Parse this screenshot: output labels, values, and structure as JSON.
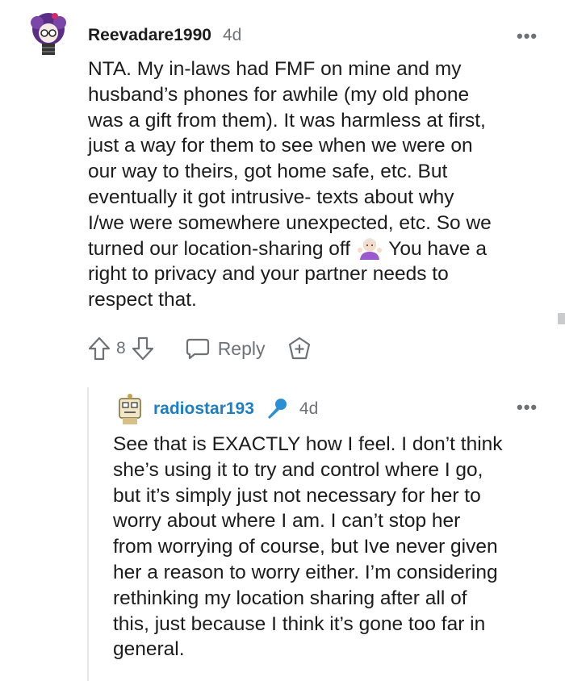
{
  "comment": {
    "username": "Reevadare1990",
    "age": "4d",
    "more_label": "•••",
    "lines": [
      "NTA. My in-laws had FMF on mine and my",
      "husband’s phones for awhile (my old phone",
      "was a gift from them). It was harmless at first,",
      "just a way for them to see when we were on",
      "our way to theirs, got home safe, etc. But",
      "eventually it got intrusive- texts about why",
      "I/we were somewhere unexpected, etc. So we",
      "turned our location-sharing off",
      "You have a",
      "right to privacy and your partner needs to",
      "respect that."
    ],
    "emoji": "woman-shrugging-emoji",
    "votes": "8",
    "reply_label": "Reply"
  },
  "reply": {
    "username": "radiostar193",
    "flair_icon": "microphone-icon",
    "age": "4d",
    "more_label": "•••",
    "lines": [
      "See that is EXACTLY how I feel. I don’t think",
      "she’s using it to try and control where I go,",
      "but it’s simply just not necessary for her to",
      "worry about where I am. I can’t stop her",
      "from worrying of course, but Ive never given",
      "her a reason to worry either. I’m considering",
      "rethinking my location sharing after all of",
      "this, just because I think it’s gone too far in",
      "general."
    ]
  },
  "colors": {
    "text": "#1c1c1c",
    "meta": "#6f7275",
    "reply_username": "#1a7fc4",
    "mic": "#2b8fd6",
    "thread_line": "#e4e6e8"
  }
}
